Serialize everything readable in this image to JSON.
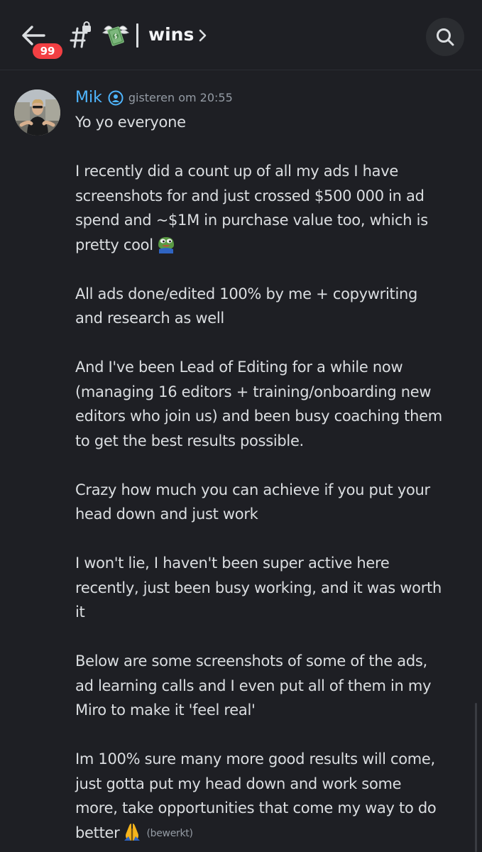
{
  "header": {
    "unread_count": "99",
    "channel_emoji": "money-with-wings-icon",
    "channel_name": "wins"
  },
  "message": {
    "author": "Mik",
    "timestamp": "gisteren om 20:55",
    "lines": [
      "Yo yo everyone",
      "",
      "I recently did a count up of all my ads I have",
      "screenshots for and just crossed $500 000 in ad",
      "spend and ~$1M in purchase value too, which is",
      "pretty cool",
      "",
      "All ads done/edited 100% by me + copywriting",
      "and research as well",
      "",
      "And I've been Lead of Editing for a while now",
      "(managing 16 editors + training/onboarding new",
      "editors who join us) and been busy coaching them",
      "to get the best results possible.",
      "",
      "Crazy how much you can achieve if you put your",
      "head down and just work",
      "",
      "I won't lie, I haven't been super active here",
      "recently, just been busy working, and it was worth",
      "it",
      "",
      "Below are some screenshots of some of the ads,",
      "ad learning calls and I even put all of them in my",
      "Miro to make it 'feel real'",
      "",
      "Im 100% sure many more good results will come,",
      "just gotta put my head down and work some",
      "more, take opportunities that come my way to do",
      "better"
    ],
    "edited_label": "(bewerkt)"
  },
  "colors": {
    "background": "#1e1f24",
    "author": "#4fb6ff",
    "text": "#dbdee1",
    "muted": "#949ba4",
    "badge": "#f23f43"
  }
}
